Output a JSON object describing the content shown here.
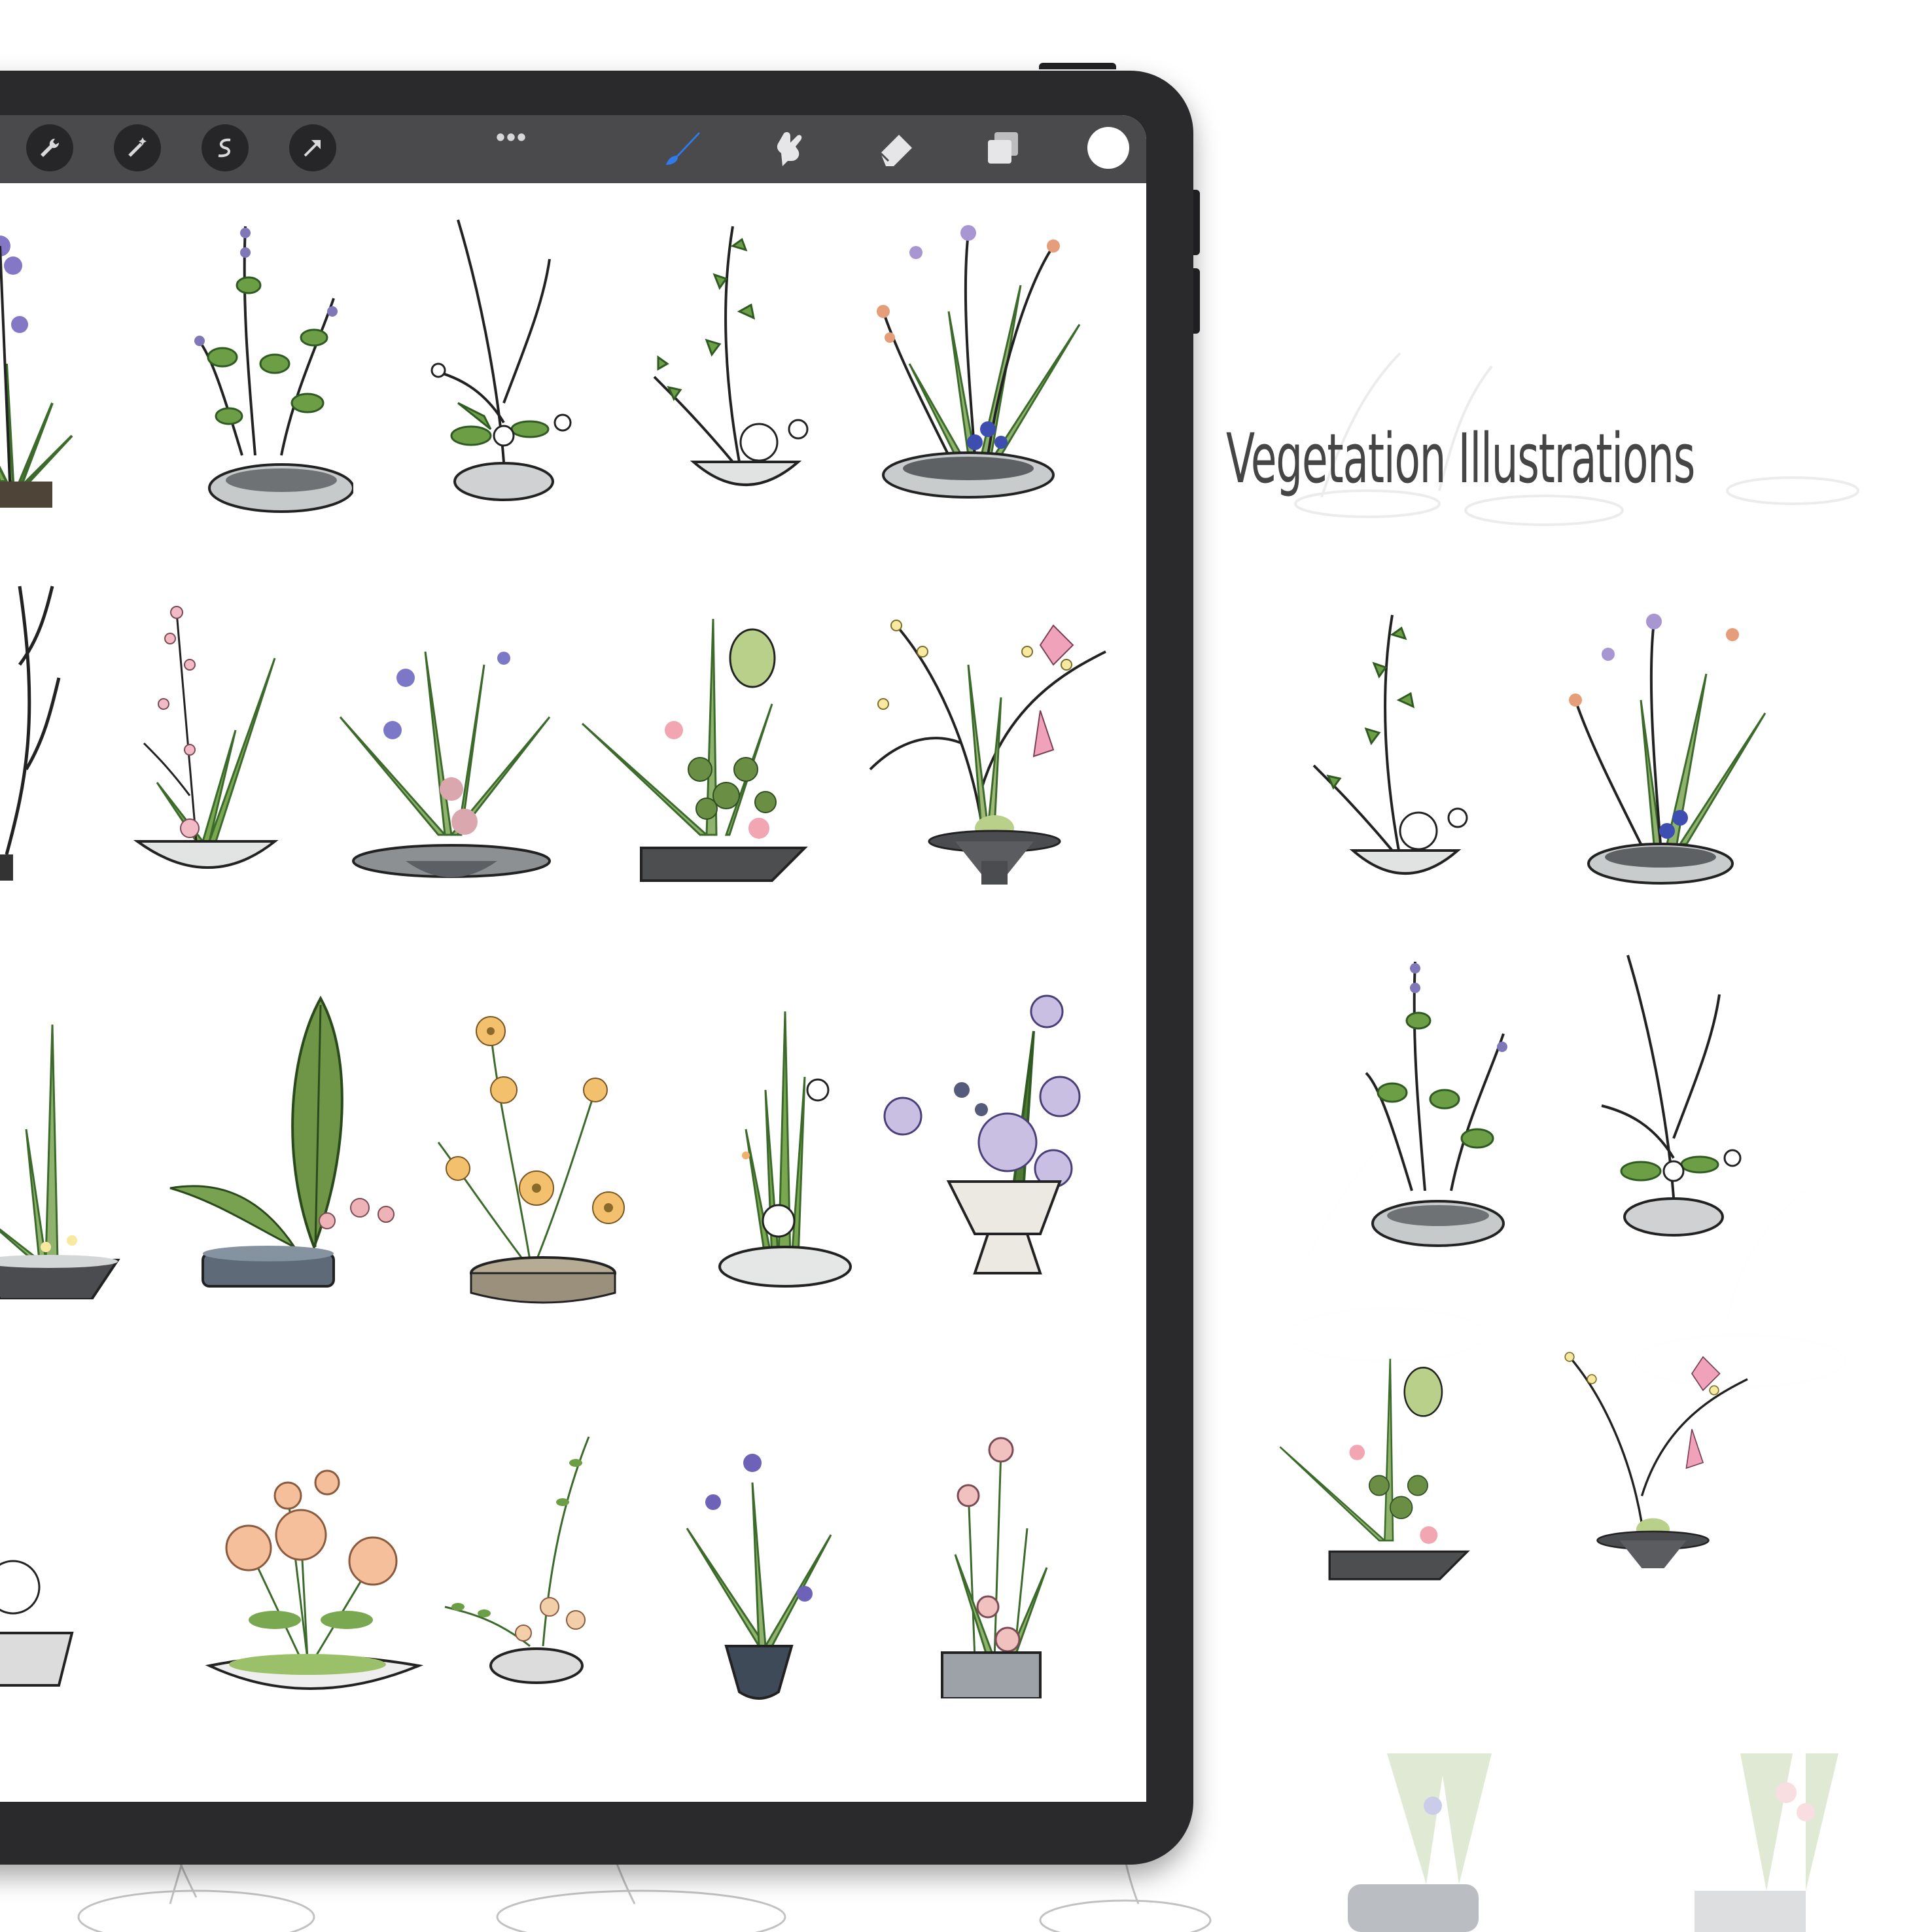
{
  "app": {
    "toolbar": {
      "left_tools": [
        {
          "name": "wrench-icon",
          "label": "Actions"
        },
        {
          "name": "magic-wand-icon",
          "label": "Adjustments"
        },
        {
          "name": "selection-icon",
          "label": "Selection"
        },
        {
          "name": "arrow-cursor-icon",
          "label": "Transform"
        }
      ],
      "more": "•••",
      "right_tools": [
        {
          "name": "brush-icon",
          "label": "Paint",
          "active": true
        },
        {
          "name": "smudge-icon",
          "label": "Smudge"
        },
        {
          "name": "eraser-icon",
          "label": "Erase"
        },
        {
          "name": "layers-icon",
          "label": "Layers"
        }
      ],
      "color": "#ffffff",
      "accent": "#2f7bea"
    }
  },
  "canvas": {
    "rows": [
      [
        "agapanthus-grass",
        "lavender-bowl",
        "branch-white-blossom",
        "vine-peony-bowl",
        "iris-agapanthus-dish"
      ],
      [
        "bare-branch",
        "pink-blossom-grass",
        "iris-wide-dish",
        "anthurium-curved-tray",
        "orchid-pedestal"
      ],
      [
        "reed-boat-dish",
        "broad-leaf-tin",
        "daisy-round-tin",
        "reed-anemone-plate",
        "lilac-footed-vase"
      ],
      [
        "white-anemone-bowl",
        "ranunculus-boat",
        "vine-small-bowl",
        "iris-dark-pot",
        "calla-grey-block"
      ]
    ]
  },
  "panel": {
    "title": "Vegetation Illustrations"
  },
  "colors": {
    "leaf": "#6f9a4a",
    "leaf_dark": "#3d6b2c",
    "stem": "#262626",
    "vase_grey": "#b9bcbd",
    "vase_dark": "#4a4c4f",
    "flower_pink": "#e8a7b4",
    "flower_purple": "#8d86c9",
    "flower_orange": "#f2b06a",
    "flower_blue": "#4b59b3"
  }
}
